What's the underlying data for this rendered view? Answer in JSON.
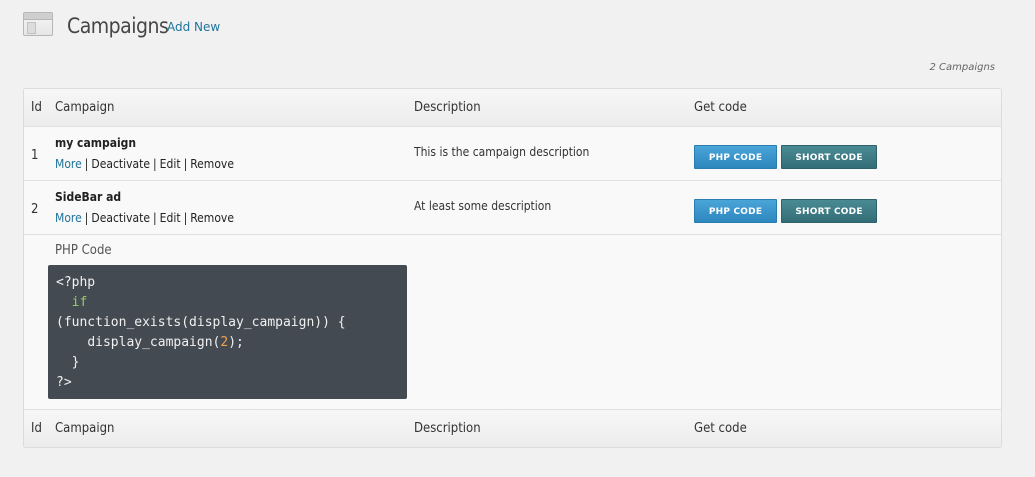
{
  "header": {
    "title": "Campaigns",
    "add_new": "Add New"
  },
  "count_text": "2 Campaigns",
  "table": {
    "columns": {
      "id": "Id",
      "campaign": "Campaign",
      "description": "Description",
      "get_code": "Get code"
    },
    "rows": [
      {
        "id": "1",
        "name": "my campaign",
        "description": "This is the campaign description",
        "actions": {
          "more": "More",
          "deactivate": "Deactivate",
          "edit": "Edit",
          "remove": "Remove"
        },
        "php_button": "PHP CODE",
        "short_button": "SHORT CODE"
      },
      {
        "id": "2",
        "name": "SideBar ad",
        "description": "At least some description",
        "actions": {
          "more": "More",
          "deactivate": "Deactivate",
          "edit": "Edit",
          "remove": "Remove"
        },
        "php_button": "PHP CODE",
        "short_button": "SHORT CODE"
      }
    ]
  },
  "code_panel": {
    "label": "PHP Code",
    "lines": {
      "open": "<?php",
      "if_kw": "if",
      "condition": "(function_exists(display_campaign)) {",
      "call_pre": "display_campaign(",
      "call_arg": "2",
      "call_post": ");",
      "close_brace": "}",
      "close": "?>"
    }
  },
  "separator": "|",
  "colors": {
    "link": "#21759b",
    "php_button": "#3a97cf",
    "short_button": "#3f7d86",
    "code_bg": "#434a52"
  }
}
